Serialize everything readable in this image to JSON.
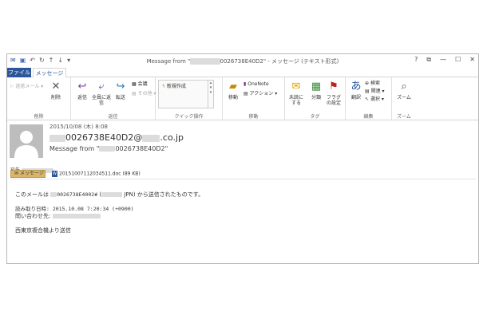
{
  "window": {
    "title_prefix": "Message from \"",
    "title_hidden": "xxxxxxxxx",
    "title_suffix": "0026738E40D2\" - メッセージ (テキスト形式)",
    "help": "?",
    "restore": "⧉",
    "minimize": "—",
    "maximize": "☐",
    "close": "✕"
  },
  "tabs": {
    "file": "ファイル",
    "message": "メッセージ"
  },
  "ribbon": {
    "group_delete": "削除",
    "junk": "迷惑メール",
    "delete": "削除",
    "group_respond": "返信",
    "reply": "返信",
    "reply_all": "全員に返信",
    "forward": "転送",
    "meeting": "会議",
    "more": "その他",
    "group_quicksteps": "クイック操作",
    "new_create": "新規作成",
    "group_move": "移動",
    "move": "移動",
    "onenote": "OneNote",
    "actions": "アクション",
    "group_tags": "タグ",
    "mark_unread": "未読にする",
    "categorize": "分類",
    "flag": "フラグの設定",
    "group_edit": "編集",
    "translate": "翻訳",
    "find": "検索",
    "related": "関連",
    "select": "選択",
    "group_zoom": "ズーム",
    "zoom": "ズーム"
  },
  "message": {
    "date": "2015/10/08 (木) 8:08",
    "from_hidden": "xxxxxxxx",
    "from_visible": "0026738E40D2@",
    "from_hidden2": "xxxxx",
    "from_domain": ".co.jp",
    "subject_prefix": "Message from \"",
    "subject_hidden": "xxxxxxxxx",
    "subject_suffix": "0026738E40D2\"",
    "to_label": "宛先",
    "to_hidden": "xxxxxxxxxxxx"
  },
  "attachments": {
    "message_tab": "メッセージ",
    "file": "20151007112034511.doc (89 KB)"
  },
  "body": {
    "line1_prefix": "このメールは",
    "line1_hidden": "xxxx",
    "line1_id": "0026738E4002#",
    "line1_hidden2": "xxxxxxx",
    "line1_suffix": "JPN) から送信されたものです。",
    "line2": "読み取り日時: 2015.10.08 7:20:34 (+0900)",
    "line3_label": "問い合わせ先:",
    "line3_hidden": "xxxxxxxxxxxxxxxxxxxxxx",
    "line4": "西東京複合機より送信"
  }
}
